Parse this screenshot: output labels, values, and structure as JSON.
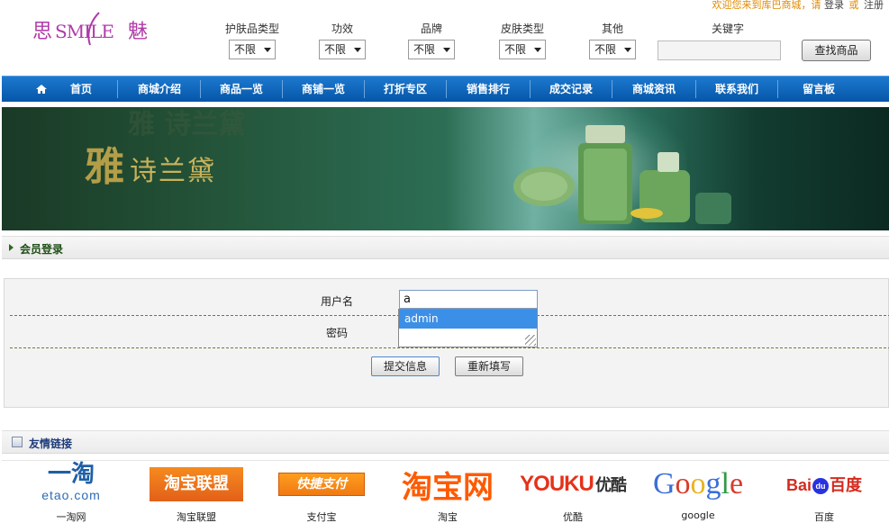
{
  "topbar": {
    "welcome": "欢迎您来到库巴商城，请",
    "login": "登录",
    "sep": "或",
    "register": "注册"
  },
  "logo": {
    "text_left": "思",
    "text_mid": "SMILE",
    "text_right": "魅"
  },
  "filters": [
    {
      "label": "护肤品类型",
      "value": "不限"
    },
    {
      "label": "功效",
      "value": "不限"
    },
    {
      "label": "品牌",
      "value": "不限"
    },
    {
      "label": "皮肤类型",
      "value": "不限"
    },
    {
      "label": "其他",
      "value": "不限"
    }
  ],
  "keyword": {
    "label": "关键字",
    "value": ""
  },
  "search_button": "查找商品",
  "nav": [
    "首页",
    "商城介绍",
    "商品一览",
    "商铺一览",
    "打折专区",
    "销售排行",
    "成交记录",
    "商城资讯",
    "联系我们",
    "留言板"
  ],
  "banner": {
    "brand": "雅",
    "brand_sub": "诗兰黛",
    "ghost": "雅 诗兰黛"
  },
  "login_section": {
    "title": "会员登录",
    "username_label": "用户名",
    "username_value": "a",
    "suggestion": "admin",
    "password_label": "密码",
    "submit": "提交信息",
    "reset": "重新填写"
  },
  "links_section": {
    "title": "友情链接",
    "items": [
      {
        "logo": "一淘",
        "logo_sub": "etao.com",
        "caption": "一淘网"
      },
      {
        "logo": "淘宝联盟",
        "caption": "淘宝联盟"
      },
      {
        "logo": "快捷支付",
        "caption": "支付宝"
      },
      {
        "logo": "淘宝网",
        "caption": "淘宝"
      },
      {
        "logo": "YOUKU",
        "logo_sub": "优酷",
        "caption": "优酷"
      },
      {
        "logo": "Google",
        "caption": "google"
      },
      {
        "logo": "Bai",
        "logo_paw": "du",
        "logo_sub": "百度",
        "caption": "百度"
      }
    ]
  },
  "colors": {
    "nav_blue": "#0a63bb",
    "accent_orange": "#e08a00",
    "link_green": "#1f4f16",
    "autocomplete_blue": "#3c8fe6"
  }
}
